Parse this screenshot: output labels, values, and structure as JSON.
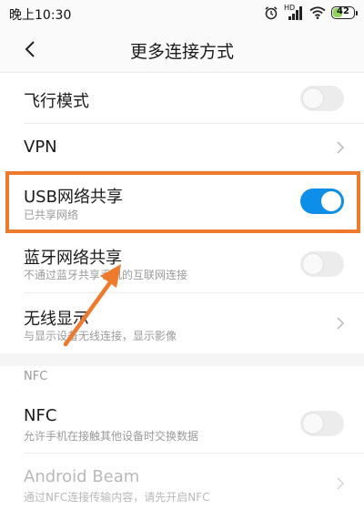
{
  "status_bar": {
    "time": "晚上10:30",
    "battery_level": "42",
    "battery_fraction": 0.42,
    "network_label": "HD",
    "icons": [
      "alarm-icon",
      "signal-icon",
      "wifi-icon",
      "battery-icon"
    ]
  },
  "header": {
    "title": "更多连接方式",
    "back_icon": "back-arrow-icon"
  },
  "settings": [
    {
      "title": "飞行模式",
      "type": "toggle",
      "on": false
    },
    {
      "title": "VPN",
      "type": "link"
    },
    {
      "title": "USB网络共享",
      "subtitle": "已共享网络",
      "type": "toggle",
      "on": true,
      "highlighted": true
    },
    {
      "title": "蓝牙网络共享",
      "subtitle": "不通过蓝牙共享手机的互联网连接",
      "type": "toggle",
      "on": false
    },
    {
      "title": "无线显示",
      "subtitle": "与显示设备无线连接，显示影像",
      "type": "link"
    }
  ],
  "nfc_section": {
    "header": "NFC",
    "items": [
      {
        "title": "NFC",
        "subtitle": "允许手机在接触其他设备时交换数据",
        "type": "toggle",
        "on": false
      },
      {
        "title": "Android Beam",
        "subtitle": "通过NFC连接传输内容，请先开启NFC",
        "type": "link",
        "disabled": true
      }
    ]
  },
  "colors": {
    "accent": "#0d8ee9",
    "annotation": "#ee7b2d",
    "toggle_off": "#ececec"
  }
}
